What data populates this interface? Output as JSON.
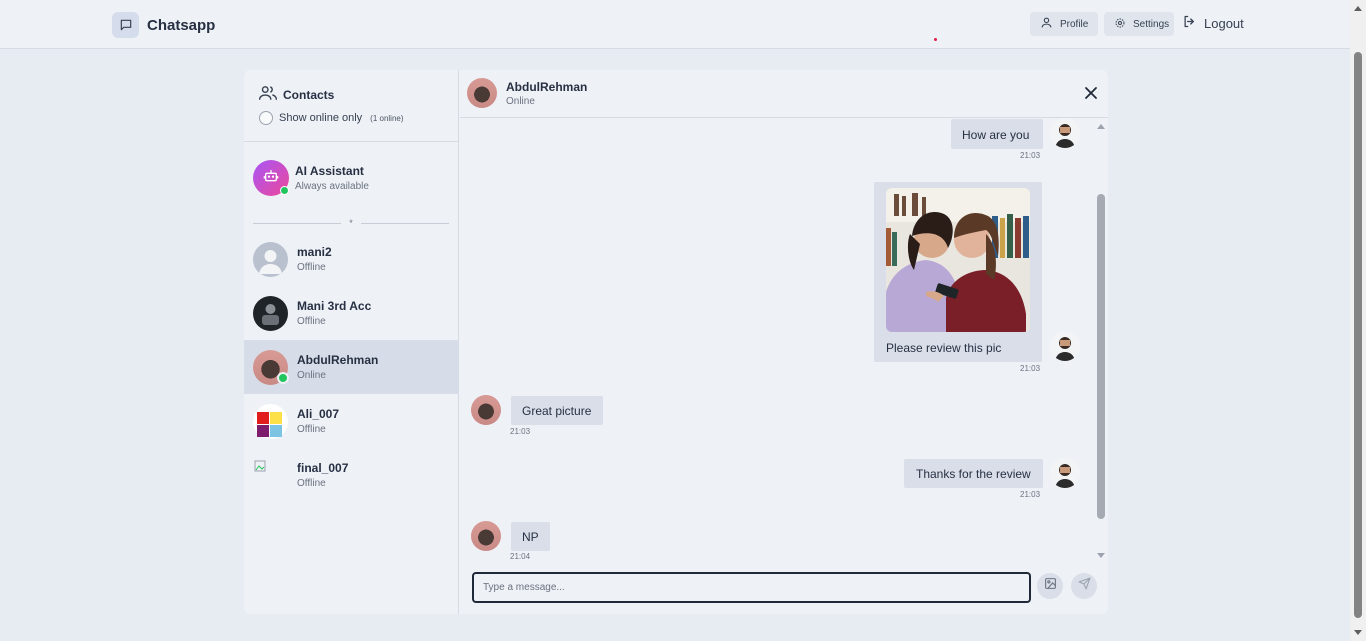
{
  "app": {
    "title": "Chatsapp",
    "nav": {
      "profile": "Profile",
      "settings": "Settings",
      "logout": "Logout"
    }
  },
  "sidebar": {
    "heading": "Contacts",
    "online_toggle_label": "Show online only",
    "online_count": "(1 online)",
    "ai": {
      "name": "AI Assistant",
      "status": "Always available"
    },
    "divider_symbol": "*",
    "contacts": [
      {
        "name": "mani2",
        "status": "Offline",
        "online": false,
        "active": false
      },
      {
        "name": "Mani 3rd Acc",
        "status": "Offline",
        "online": false,
        "active": false
      },
      {
        "name": "AbdulRehman",
        "status": "Online",
        "online": true,
        "active": true
      },
      {
        "name": "Ali_007",
        "status": "Offline",
        "online": false,
        "active": false
      },
      {
        "name": "final_007",
        "status": "Offline",
        "online": false,
        "active": false
      }
    ]
  },
  "chat": {
    "contact_name": "AbdulRehman",
    "contact_status": "Online",
    "messages": [
      {
        "from": "me",
        "text": "How are you",
        "time": "21:03"
      },
      {
        "from": "me",
        "text": "Please review this pic",
        "time": "21:03",
        "has_image": true
      },
      {
        "from": "them",
        "text": "Great picture",
        "time": "21:03"
      },
      {
        "from": "me",
        "text": "Thanks for the review",
        "time": "21:03"
      },
      {
        "from": "them",
        "text": "NP",
        "time": "21:04"
      }
    ],
    "composer_placeholder": "Type a message..."
  },
  "colors": {
    "background": "#e7ebf2",
    "panel": "#eef1f6",
    "bubble": "#d9dee8",
    "active_row": "#d7dde8",
    "online": "#22c55e"
  }
}
